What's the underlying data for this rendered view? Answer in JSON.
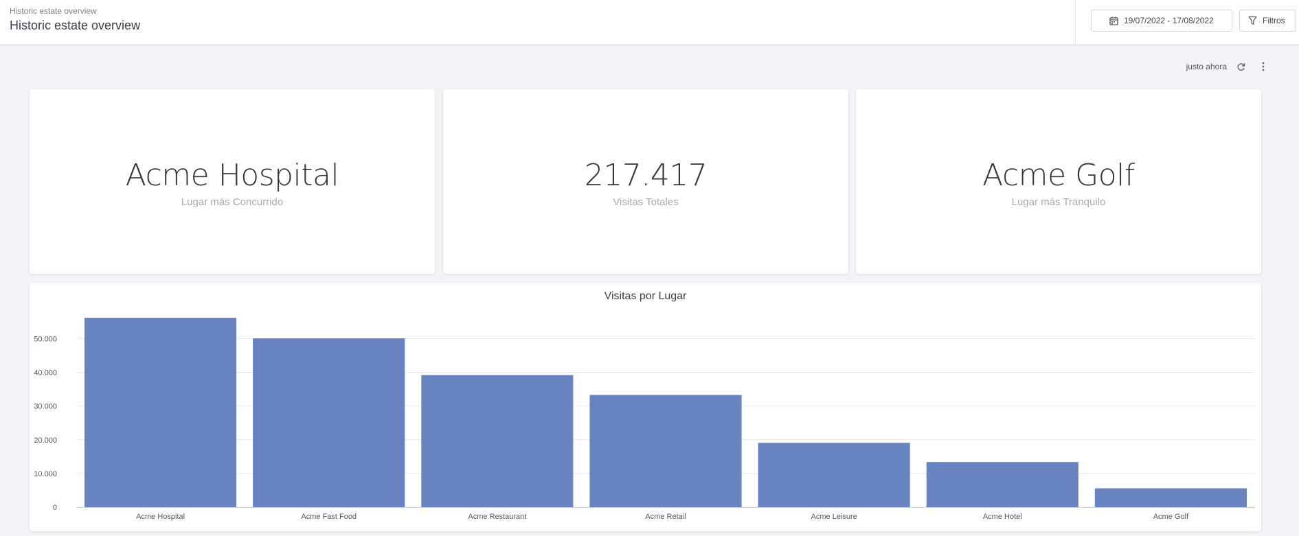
{
  "header": {
    "breadcrumb": "Historic estate overview",
    "title": "Historic estate overview",
    "date_range": "19/07/2022 - 17/08/2022",
    "filters_label": "Filtros"
  },
  "toolbar": {
    "refresh_status": "justo ahora"
  },
  "kpis": [
    {
      "value": "Acme Hospital",
      "label": "Lugar más Concurrido"
    },
    {
      "value": "217.417",
      "label": "Visitas Totales"
    },
    {
      "value": "Acme Golf",
      "label": "Lugar más Tranquilo"
    }
  ],
  "colors": {
    "bar": "#6884c0",
    "grid": "#e6e8ec",
    "axis_text": "#555555"
  },
  "chart_data": {
    "type": "bar",
    "title": "Visitas por Lugar",
    "categories": [
      "Acme Hospital",
      "Acme Fast Food",
      "Acme Restaurant",
      "Acme Retail",
      "Acme Leisure",
      "Acme Hotel",
      "Acme Golf"
    ],
    "values": [
      56200,
      50100,
      39200,
      33300,
      19100,
      13400,
      5600
    ],
    "ylim": [
      0,
      56200
    ],
    "yticks": [
      0,
      10000,
      20000,
      30000,
      40000,
      50000
    ],
    "ytick_labels": [
      "0",
      "10.000",
      "20.000",
      "30.000",
      "40.000",
      "50.000"
    ],
    "grid": true,
    "legend": "none"
  }
}
